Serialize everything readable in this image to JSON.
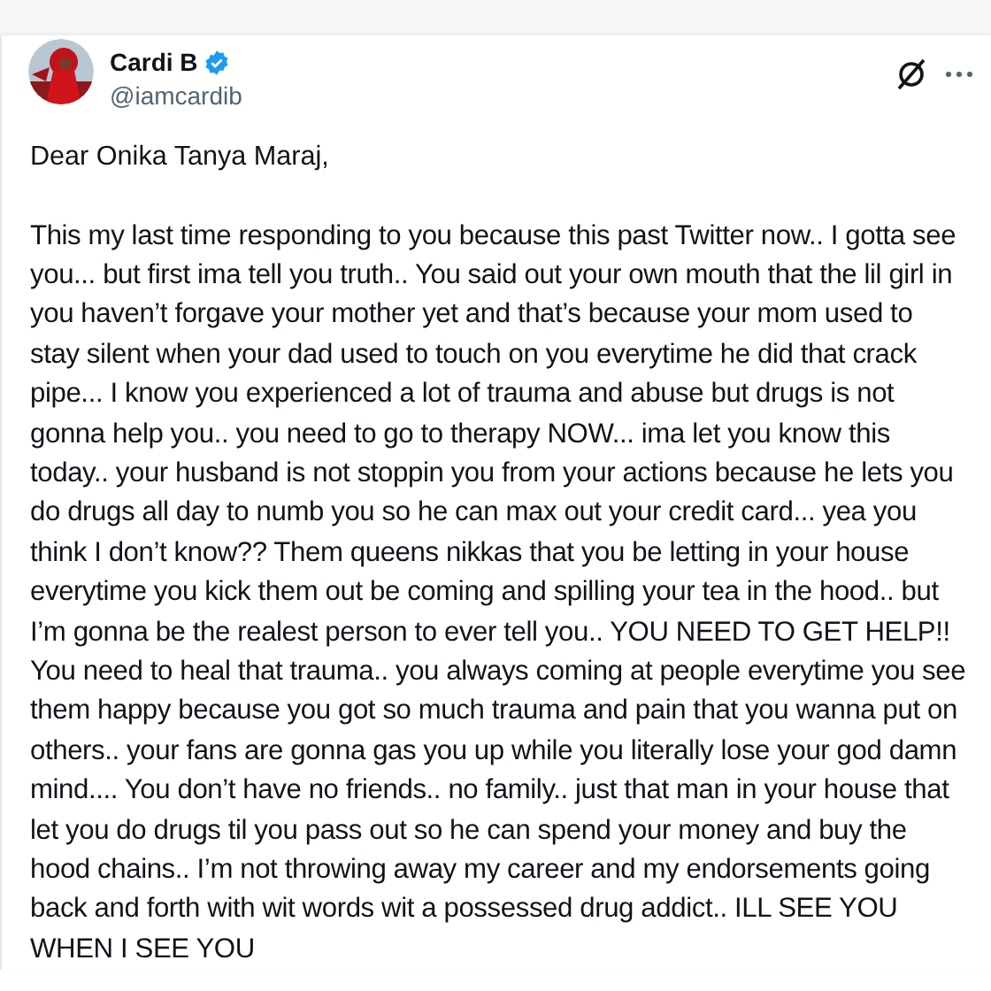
{
  "post": {
    "author": "Cardi B",
    "verified": true,
    "handle": "@iamcardib",
    "greeting": "Dear Onika Tanya Maraj,",
    "body": "This my last time responding to you because this past Twitter now.. I gotta see you... but first ima tell you truth.. You said out your own mouth that the lil girl in you haven’t forgave your mother yet and that’s because your mom used to stay silent when your dad used to touch on you everytime he did that crack pipe... I know you experienced a lot of trauma and abuse but drugs is not gonna help you.. you need to go to therapy NOW... ima let you know this today.. your husband is not stoppin you from your actions because he lets you do drugs all day to numb you so he can max out your credit card... yea you think I don’t know?? Them queens nikkas that you be letting in your house everytime you kick them out be coming and spilling your tea in the hood.. but I’m gonna be the realest person to ever tell you.. YOU NEED TO GET HELP!! You need to heal that trauma.. you always coming at people everytime you see them happy because you got so much trauma and pain that you wanna put on others.. your fans are gonna gas you up while you literally lose your god damn mind.... You don’t have no friends.. no family.. just that man in your house that let you do drugs til you pass out so he can spend your money and buy the hood chains.. I’m not throwing away my career and my endorsements going back and forth with wit words wit a possessed drug addict.. ILL SEE YOU WHEN I SEE YOU"
  }
}
